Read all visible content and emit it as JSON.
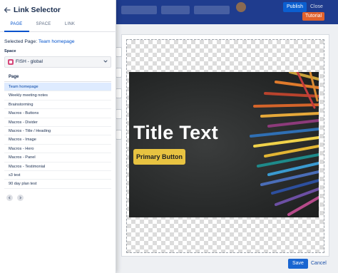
{
  "topbar": {
    "publish_label": "Publish",
    "close_label": "Close"
  },
  "editor": {
    "tutorial_label": "Tutorial",
    "hero": {
      "title": "Title Text",
      "button_label": "Primary Button"
    },
    "footer": {
      "save_label": "Save",
      "cancel_label": "Cancel"
    }
  },
  "panel": {
    "title": "Link Selector",
    "tabs": [
      {
        "label": "PAGE",
        "active": true
      },
      {
        "label": "SPACE",
        "active": false
      },
      {
        "label": "LINK",
        "active": false
      }
    ],
    "selected_prefix": "Selected Page: ",
    "selected_page": "Team homepage",
    "space_label": "Space",
    "space_value": "FISH - global",
    "pages_header": "Page",
    "pages": [
      "Team homepage",
      "Weekly meeting notes",
      "Brainstorming",
      "Macros - Buttons",
      "Macros - Divider",
      "Macros - Title / Heading",
      "Macros - Image",
      "Macros - Hero",
      "Macros - Panel",
      "Macros - Testimonial",
      "s3 test",
      "90 day plan test"
    ],
    "selected_index": 0
  },
  "colors": {
    "header_blue": "#1f3c8e",
    "accent_blue": "#0052cc",
    "tutorial_orange": "#e0622d",
    "hero_button_yellow": "#e8c341",
    "save_blue": "#1a66d1"
  },
  "icons": {
    "back": "arrow-left-icon",
    "space_chevron": "chevron-down-icon",
    "space_icon": "space-avatar-icon",
    "pager_prev": "chevron-left-icon",
    "pager_next": "chevron-right-icon"
  }
}
